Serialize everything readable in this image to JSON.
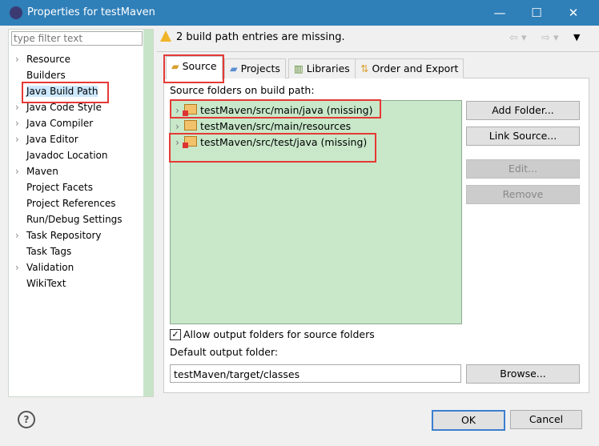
{
  "window": {
    "title": "Properties for testMaven",
    "minimize": "—",
    "maximize": "☐",
    "close": "✕"
  },
  "sidebar": {
    "filter_placeholder": "type filter text",
    "items": [
      {
        "label": "Resource",
        "expandable": true
      },
      {
        "label": "Builders",
        "expandable": false
      },
      {
        "label": "Java Build Path",
        "expandable": false,
        "selected": true
      },
      {
        "label": "Java Code Style",
        "expandable": true
      },
      {
        "label": "Java Compiler",
        "expandable": true
      },
      {
        "label": "Java Editor",
        "expandable": true
      },
      {
        "label": "Javadoc Location",
        "expandable": false
      },
      {
        "label": "Maven",
        "expandable": true
      },
      {
        "label": "Project Facets",
        "expandable": false
      },
      {
        "label": "Project References",
        "expandable": false
      },
      {
        "label": "Run/Debug Settings",
        "expandable": false
      },
      {
        "label": "Task Repository",
        "expandable": true
      },
      {
        "label": "Task Tags",
        "expandable": false
      },
      {
        "label": "Validation",
        "expandable": true
      },
      {
        "label": "WikiText",
        "expandable": false
      }
    ]
  },
  "header": {
    "message": "2 build path entries are missing.",
    "warning_icon": "warning-icon"
  },
  "tabs": [
    {
      "label": "Source",
      "active": true
    },
    {
      "label": "Projects"
    },
    {
      "label": "Libraries"
    },
    {
      "label": "Order and Export"
    }
  ],
  "source": {
    "list_label": "Source folders on build path:",
    "folders": [
      {
        "label": "testMaven/src/main/java (missing)",
        "missing": true
      },
      {
        "label": "testMaven/src/main/resources",
        "missing": false
      },
      {
        "label": "testMaven/src/test/java (missing)",
        "missing": true
      }
    ],
    "buttons": {
      "add": "Add Folder...",
      "link": "Link Source...",
      "edit": "Edit...",
      "remove": "Remove"
    },
    "allow_output": {
      "label": "Allow output folders for source folders",
      "checked": true
    },
    "output_label": "Default output folder:",
    "output_value": "testMaven/target/classes",
    "browse": "Browse..."
  },
  "footer": {
    "ok": "OK",
    "cancel": "Cancel",
    "help": "?"
  },
  "colors": {
    "titlebar": "#2f7fb8",
    "list_bg": "#c8e8c9",
    "annotation": "#e53935"
  }
}
